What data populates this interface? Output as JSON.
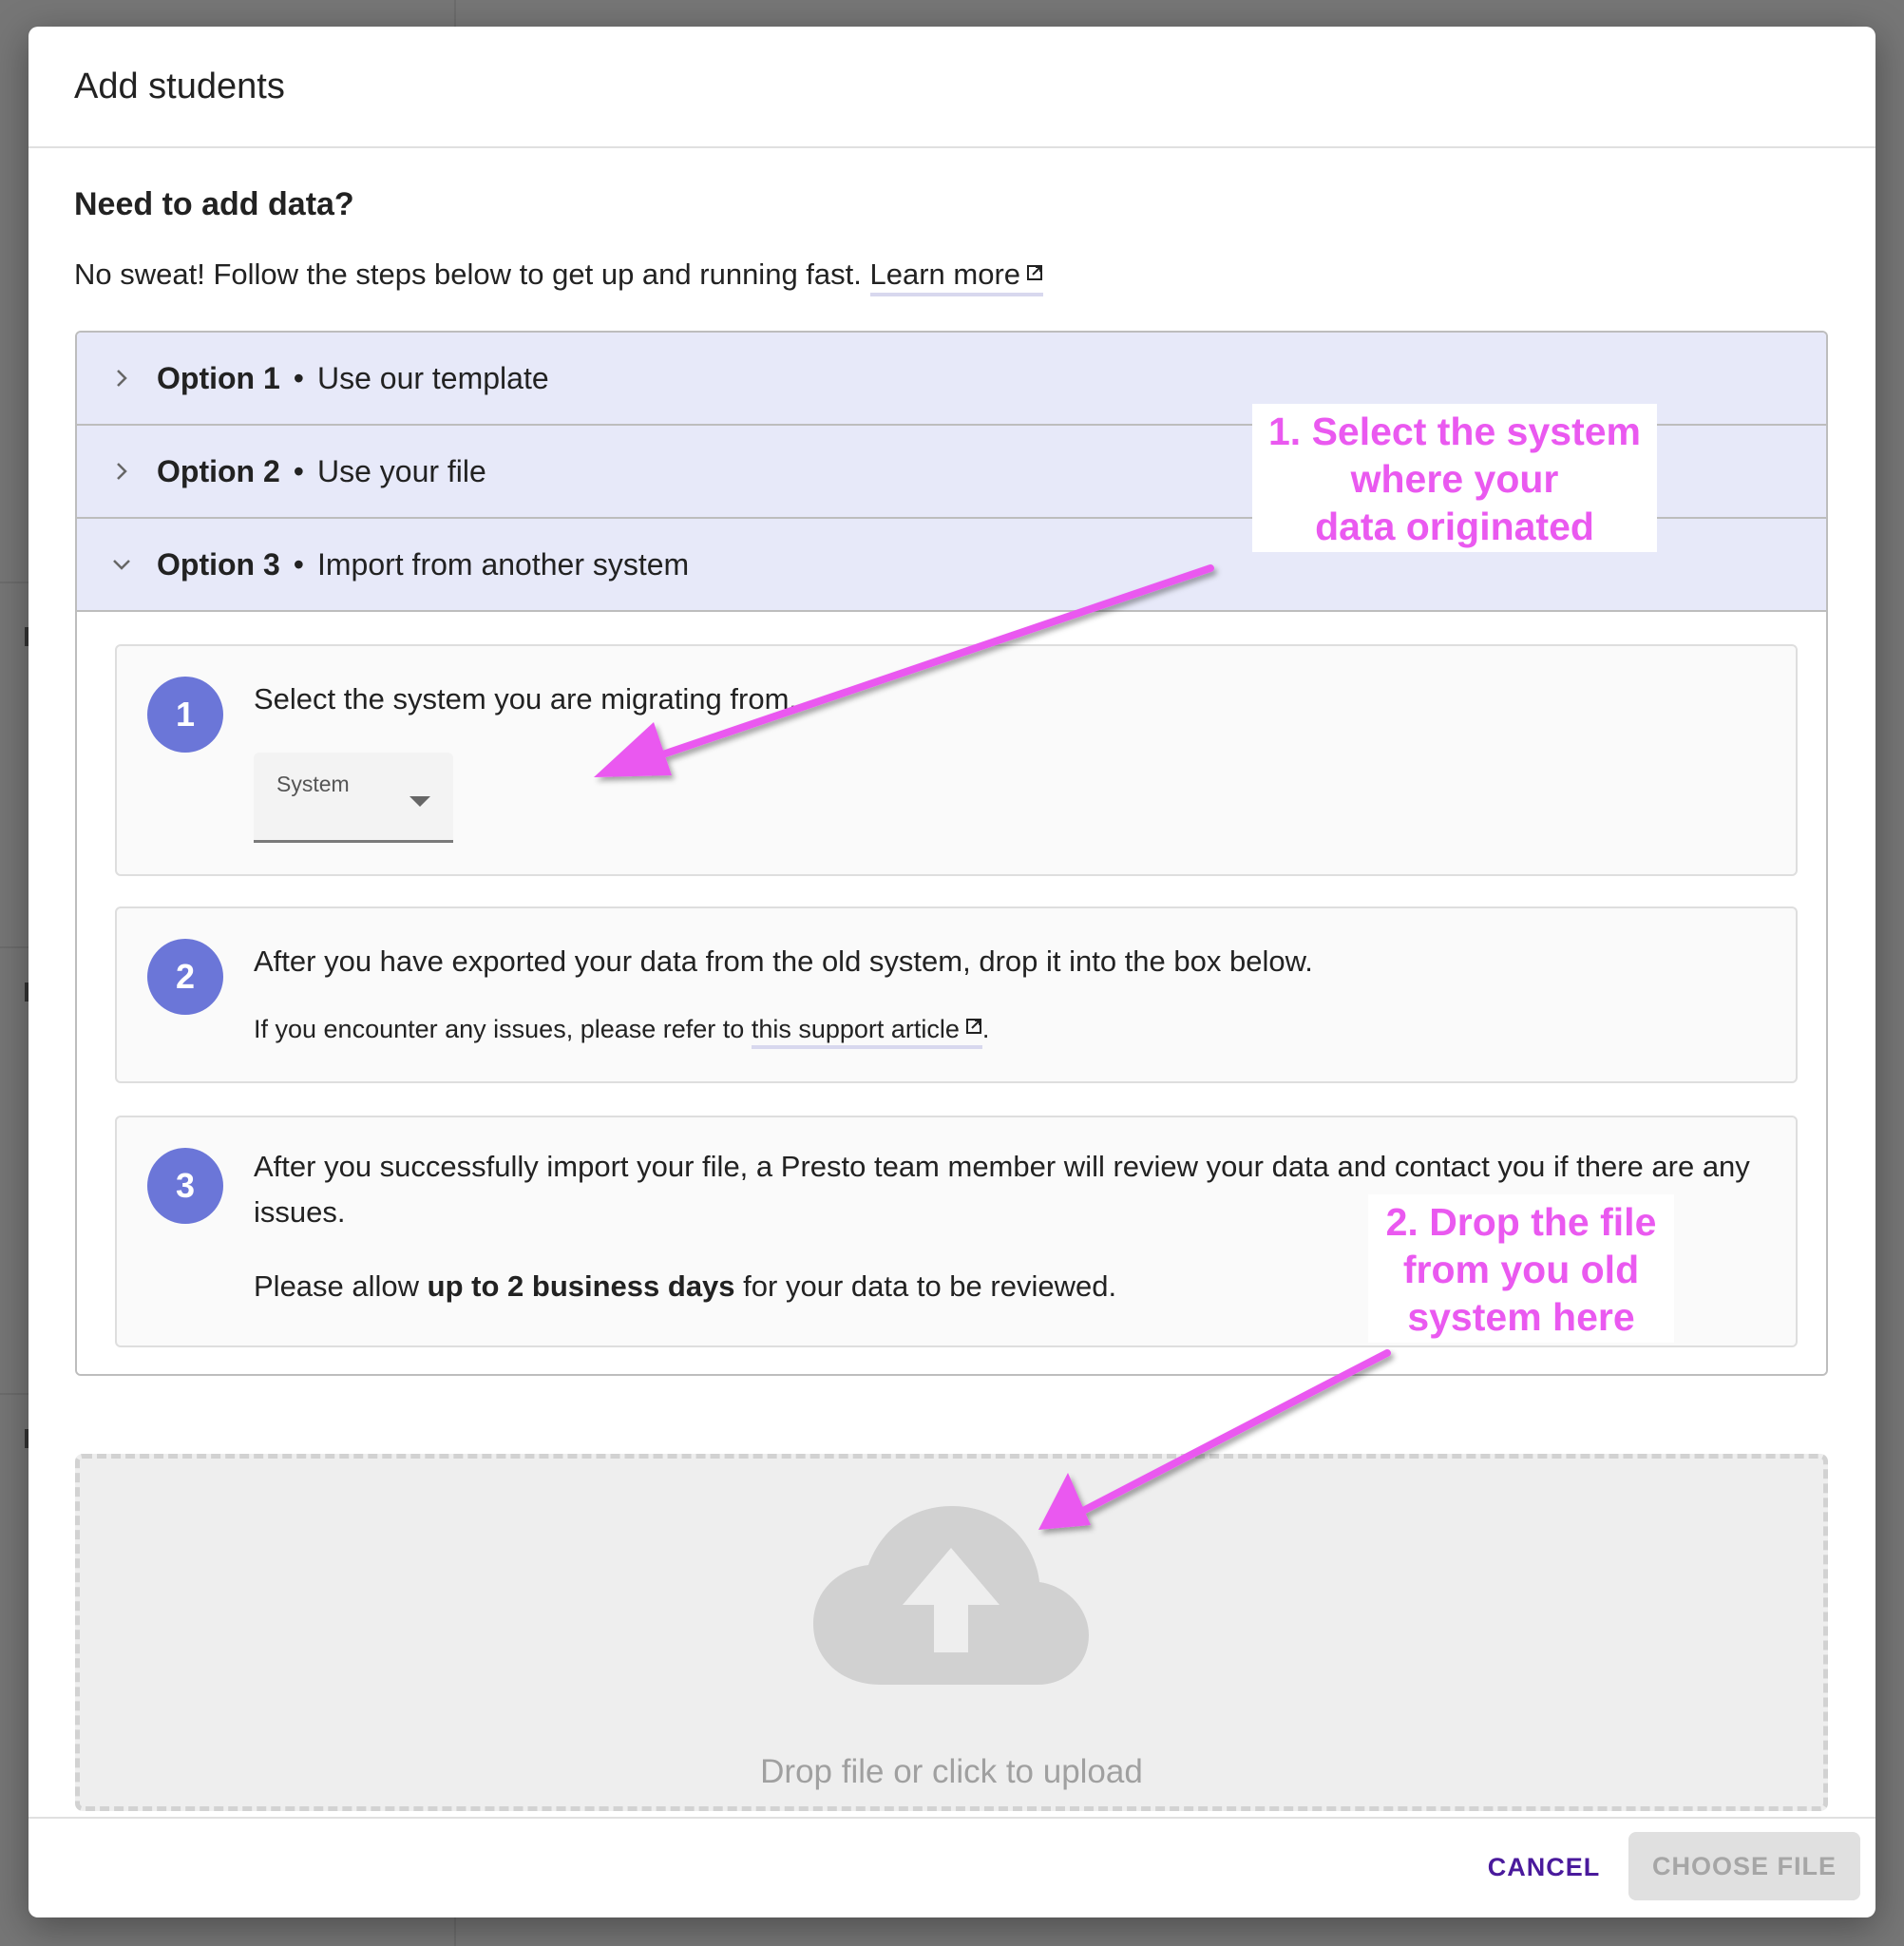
{
  "dialog": {
    "title": "Add students",
    "section_title": "Need to add data?",
    "intro_text": "No sweat! Follow the steps below to get up and running fast.",
    "learn_more_label": "Learn more"
  },
  "accordion": {
    "options": [
      {
        "label": "Option 1",
        "separator": "•",
        "description": "Use our template",
        "expanded": false
      },
      {
        "label": "Option 2",
        "separator": "•",
        "description": "Use your file",
        "expanded": false
      },
      {
        "label": "Option 3",
        "separator": "•",
        "description": "Import from another system",
        "expanded": true
      }
    ]
  },
  "steps": [
    {
      "number": "1",
      "text": "Select the system you are migrating from.",
      "select": {
        "label": "System",
        "value": ""
      }
    },
    {
      "number": "2",
      "text": "After you have exported your data from the old system, drop it into the box below.",
      "sub_prefix": "If you encounter any issues, please refer to",
      "sub_link": "this support article",
      "sub_suffix": "."
    },
    {
      "number": "3",
      "text": "After you successfully import your file, a Presto team member will review your data and contact you if there are any issues.",
      "note_prefix": "Please allow",
      "note_bold": "up to 2 business days",
      "note_suffix": "for your data to be reviewed."
    }
  ],
  "dropzone": {
    "icon": "cloud-upload-icon",
    "text": "Drop file or click to upload"
  },
  "footer": {
    "cancel_label": "CANCEL",
    "choose_file_label": "CHOOSE FILE"
  },
  "annotations": [
    {
      "text_lines": [
        "1. Select the system",
        "where your",
        "data originated"
      ]
    },
    {
      "text_lines": [
        "2. Drop the file",
        "from you old",
        "system here"
      ]
    }
  ],
  "colors": {
    "accent": "#4a1a9c",
    "step_badge": "#6b76d8",
    "accordion_header": "#e7e9f9",
    "annotation": "#ea59f0"
  }
}
